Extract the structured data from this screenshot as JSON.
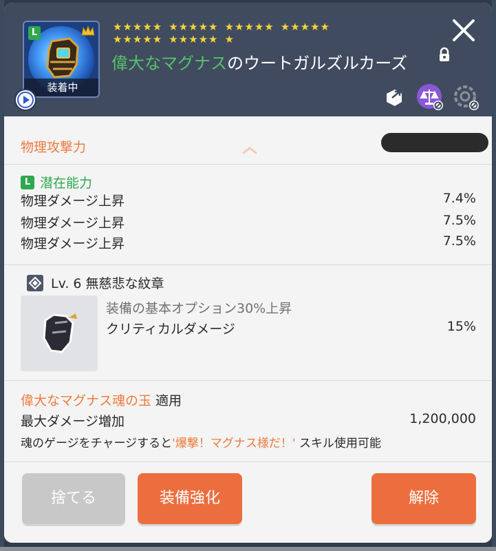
{
  "header": {
    "grade_badge": "L",
    "equipped_label": "装着中",
    "star_groups": [
      "★★★★★",
      "★★★★★",
      "★★★★★",
      "★★★★★",
      "★★★★★",
      "★★★★★",
      "★"
    ],
    "item_name_highlight": "偉大なマグナス",
    "item_name_rest": "のウートガルズルカーズ",
    "icons": [
      "play-icon",
      "lock-icon",
      "close-icon",
      "share-icon",
      "balance-icon",
      "gear-disabled-icon",
      "crown-icon"
    ]
  },
  "attack": {
    "label": "物理攻撃力"
  },
  "potential": {
    "badge": "L",
    "title": "潜在能力",
    "rows": [
      {
        "name": "物理ダメージ上昇",
        "value": "7.4%"
      },
      {
        "name": "物理ダメージ上昇",
        "value": "7.5%"
      },
      {
        "name": "物理ダメージ上昇",
        "value": "7.5%"
      }
    ]
  },
  "emblem": {
    "title": "Lv. 6 無慈悲な紋章",
    "sub": "装備の基本オプション30%上昇",
    "stat_name": "クリティカルダメージ",
    "stat_value": "15%"
  },
  "soul": {
    "name": "偉大なマグナス魂の玉",
    "applied": " 適用",
    "stat_name": "最大ダメージ増加",
    "stat_value": "1,200,000",
    "desc_pre": "魂のゲージをチャージすると",
    "desc_quote": "'爆撃！マグナス様だ！'",
    "desc_post": " スキル使用可能"
  },
  "buttons": {
    "discard": "捨てる",
    "enhance": "装備強化",
    "release": "解除"
  },
  "colors": {
    "header_bg": "#404b5f",
    "accent_orange": "#ec6e3e",
    "grade_green": "#2fa84f",
    "star_yellow": "#f5d33a"
  }
}
